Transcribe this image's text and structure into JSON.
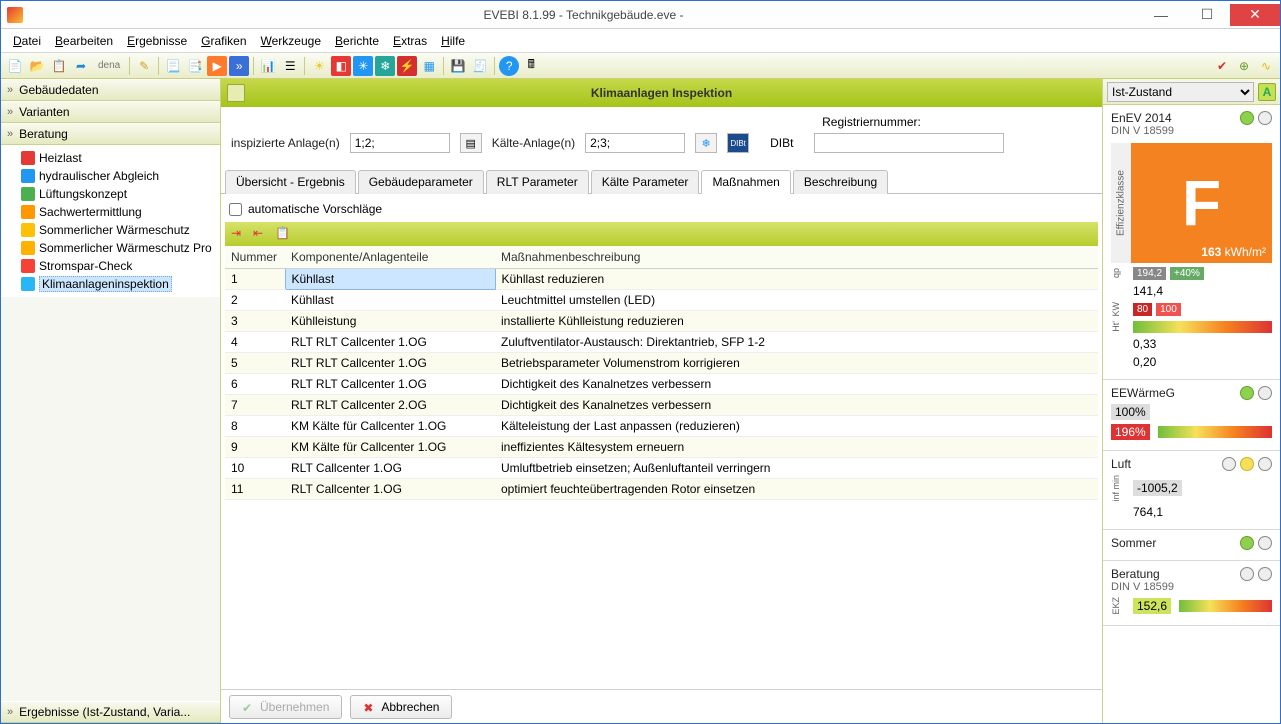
{
  "window": {
    "title": "EVEBI 8.1.99 - Technikgebäude.eve -"
  },
  "menu": [
    "Datei",
    "Bearbeiten",
    "Ergebnisse",
    "Grafiken",
    "Werkzeuge",
    "Berichte",
    "Extras",
    "Hilfe"
  ],
  "toolbar_dena": "dena",
  "sidebar": {
    "sections": [
      {
        "label": "Gebäudedaten"
      },
      {
        "label": "Varianten"
      },
      {
        "label": "Beratung"
      }
    ],
    "tree": [
      {
        "label": "Heizlast",
        "color": "#e53935"
      },
      {
        "label": "hydraulischer Abgleich",
        "color": "#2196f3"
      },
      {
        "label": "Lüftungskonzept",
        "color": "#4caf50"
      },
      {
        "label": "Sachwertermittlung",
        "color": "#ff9800"
      },
      {
        "label": "Sommerlicher Wärmeschutz",
        "color": "#ffc107"
      },
      {
        "label": "Sommerlicher Wärmeschutz Pro",
        "color": "#ffb300"
      },
      {
        "label": "Stromspar-Check",
        "color": "#f44336"
      },
      {
        "label": "Klimaanlageninspektion",
        "color": "#29b6f6",
        "selected": true
      }
    ],
    "bottom": "Ergebnisse (Ist-Zustand, Varia..."
  },
  "page": {
    "title": "Klimaanlagen Inspektion",
    "filters": {
      "insp_label": "inspizierte Anlage(n)",
      "insp_value": "1;2;",
      "kalte_label": "Kälte-Anlage(n)",
      "kalte_value": "2;3;",
      "dibt_label": "DIBt",
      "reg_label": "Registriernummer:",
      "reg_value": ""
    },
    "tabs": [
      "Übersicht - Ergebnis",
      "Gebäudeparameter",
      "RLT Parameter",
      "Kälte Parameter",
      "Maßnahmen",
      "Beschreibung"
    ],
    "active_tab": 4,
    "auto_label": "automatische Vorschläge",
    "auto_checked": false,
    "columns": [
      "Nummer",
      "Komponente/Anlagenteile",
      "Maßnahmenbeschreibung"
    ],
    "rows": [
      {
        "n": "1",
        "k": "Kühllast",
        "m": "Kühllast reduzieren",
        "sel": true
      },
      {
        "n": "2",
        "k": "Kühllast",
        "m": "Leuchtmittel umstellen (LED)"
      },
      {
        "n": "3",
        "k": "Kühlleistung",
        "m": "installierte Kühlleistung reduzieren"
      },
      {
        "n": "4",
        "k": "RLT RLT Callcenter 1.OG",
        "m": "Zuluftventilator-Austausch: Direktantrieb, SFP 1-2"
      },
      {
        "n": "5",
        "k": "RLT RLT Callcenter 1.OG",
        "m": "Betriebsparameter Volumenstrom korrigieren"
      },
      {
        "n": "6",
        "k": "RLT RLT Callcenter 1.OG",
        "m": "Dichtigkeit des Kanalnetzes verbessern"
      },
      {
        "n": "7",
        "k": "RLT RLT Callcenter 2.OG",
        "m": "Dichtigkeit des Kanalnetzes verbessern"
      },
      {
        "n": "8",
        "k": "KM Kälte für Callcenter 1.OG",
        "m": "Kälteleistung der Last anpassen (reduzieren)"
      },
      {
        "n": "9",
        "k": "KM Kälte für Callcenter 1.OG",
        "m": "ineffizientes Kältesystem erneuern"
      },
      {
        "n": "10",
        "k": "RLT Callcenter 1.OG",
        "m": "Umluftbetrieb einsetzen; Außenluftanteil verringern"
      },
      {
        "n": "11",
        "k": "RLT Callcenter 1.OG",
        "m": "optimiert feuchteübertragenden Rotor einsetzen"
      }
    ],
    "btn_apply": "Übernehmen",
    "btn_cancel": "Abbrechen"
  },
  "right": {
    "state_select": "Ist-Zustand",
    "enev": {
      "title": "EnEV 2014",
      "sub": "DIN V 18599",
      "class_label": "Effizienzklasse",
      "class": "F",
      "value": "163",
      "unit": "kWh/m²"
    },
    "qp": {
      "v1": "194,2",
      "pct": "+40%",
      "v2": "141,4"
    },
    "kw": {
      "b1": "80",
      "b2": "100"
    },
    "ht": {
      "v1": "0,33",
      "v2": "0,20"
    },
    "eewg": {
      "title": "EEWärmeG",
      "p1": "100%",
      "p2": "196%"
    },
    "luft": {
      "title": "Luft",
      "v1": "-1005,2",
      "v2": "764,1"
    },
    "sommer": {
      "title": "Sommer"
    },
    "beratung": {
      "title": "Beratung",
      "sub": "DIN V 18599",
      "v": "152,6"
    }
  }
}
